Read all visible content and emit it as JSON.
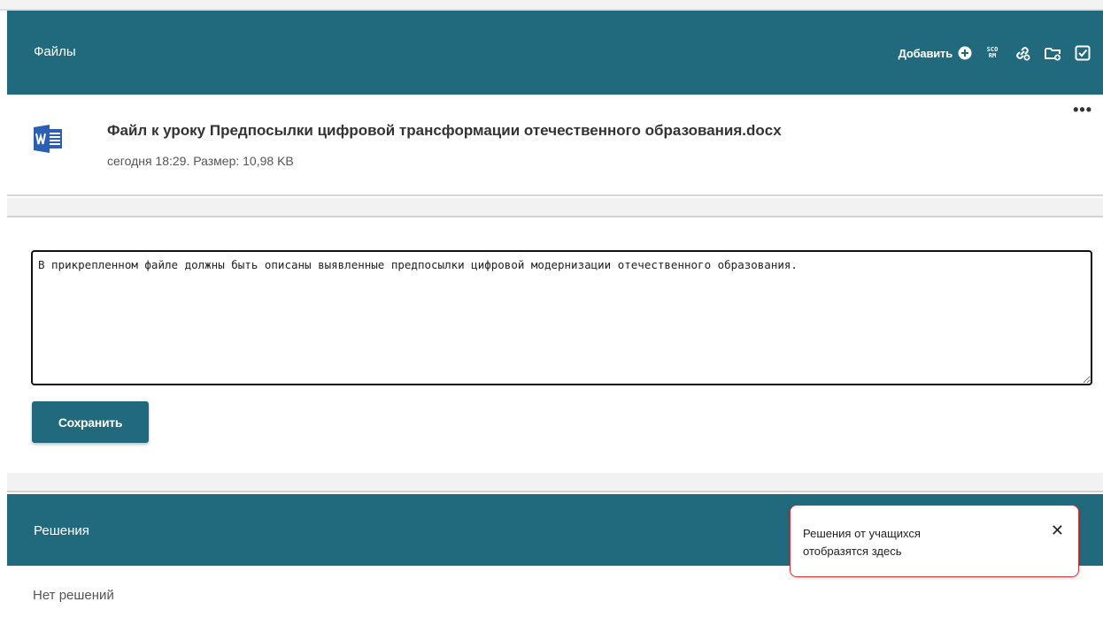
{
  "files_panel": {
    "title": "Файлы",
    "add_label": "Добавить",
    "icons": [
      "plus-circle-icon",
      "scorm-icon",
      "link-add-icon",
      "folder-add-icon",
      "checkbox-icon"
    ],
    "scorm_text_top": "SCO",
    "scorm_text_bottom": "RM"
  },
  "file": {
    "icon": "word-doc-icon",
    "name": "Файл к уроку Предпосылки цифровой трансформации отечественного образования.docx",
    "meta": "сегодня 18:29. Размер: 10,98 KB",
    "more": "•••"
  },
  "comment": {
    "value": "В прикрепленном файле должны быть описаны выявленные предпосылки цифровой модернизации отечественного образования."
  },
  "save_button": "Сохранить",
  "solutions_panel": {
    "title": "Решения",
    "empty_text": "Нет решений"
  },
  "toast": {
    "text": "Решения от учащихся отобразятся здесь",
    "close": "✕"
  },
  "colors": {
    "header_bg": "#216a7e",
    "toast_border": "#e03030",
    "word_blue": "#2b5fb4"
  }
}
